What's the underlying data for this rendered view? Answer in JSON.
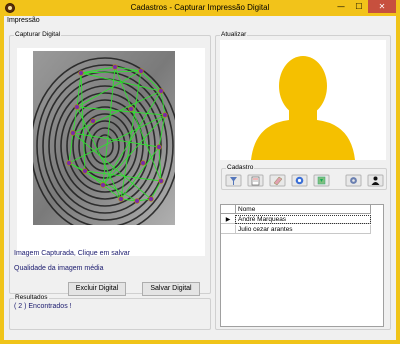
{
  "window": {
    "title": "Cadastros - Capturar Impressão Digital",
    "minimize": "—",
    "maximize": "☐",
    "close": "✕"
  },
  "menu": {
    "items": [
      "Impressão"
    ]
  },
  "capture": {
    "group_label": "Capturar Digital",
    "status_text": "Imagem Capturada,  Clique em salvar",
    "quality_text": "Qualidade da imagem média",
    "delete_button": "Excluir Digital",
    "save_button": "Salvar Digital"
  },
  "results": {
    "group_label": "Resultados",
    "text": "( 2 ) Encontrados !"
  },
  "update": {
    "group_label": "Atualizar"
  },
  "cadastro": {
    "group_label": "Cadastro",
    "toolbar_icons": [
      "pin-icon",
      "edit-document-icon",
      "eraser-icon",
      "refresh-icon",
      "download-icon",
      "settings-icon",
      "user-icon"
    ]
  },
  "grid": {
    "column_header": "Nome",
    "row_indicator": "▶",
    "rows": [
      "André Marqueas",
      "Julio cezar arantes"
    ]
  },
  "colors": {
    "window_frame": "#f2c31a",
    "close_button": "#c7503e",
    "avatar": "#f5c000",
    "minutiae_lines": "#2ee02e",
    "minutiae_points": "#7b2aa8"
  }
}
